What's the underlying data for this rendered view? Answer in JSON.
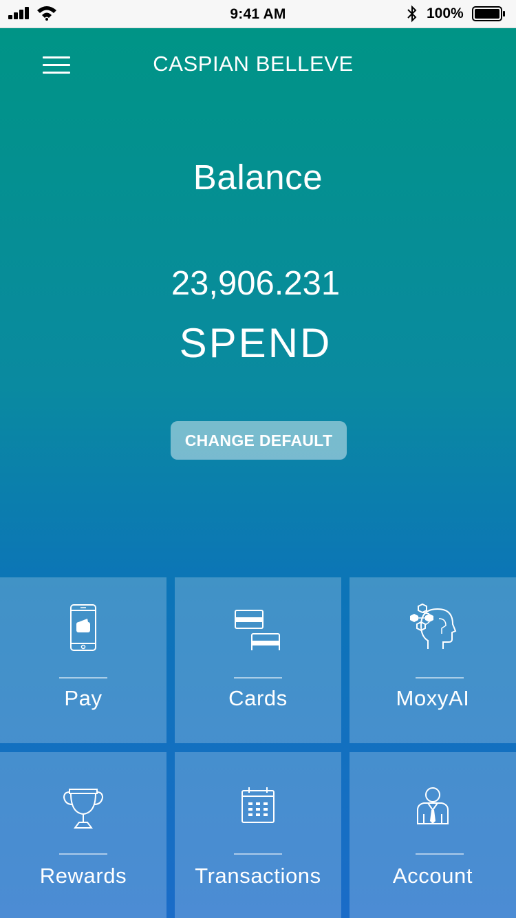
{
  "status_bar": {
    "time": "9:41 AM",
    "battery_percent": "100%",
    "icons": [
      "signal-icon",
      "wifi-icon",
      "bluetooth-icon",
      "battery-icon"
    ]
  },
  "header": {
    "title": "CASPIAN BELLEVE",
    "menu_icon": "hamburger-menu-icon"
  },
  "balance": {
    "label": "Balance",
    "amount": "23,906.231",
    "currency": "SPEND"
  },
  "change_default_button": "CHANGE DEFAULT",
  "tiles": [
    {
      "label": "Pay",
      "icon": "mobile-wallet-icon"
    },
    {
      "label": "Cards",
      "icon": "cards-icon"
    },
    {
      "label": "MoxyAI",
      "icon": "ai-head-icon"
    },
    {
      "label": "Rewards",
      "icon": "trophy-icon"
    },
    {
      "label": "Transactions",
      "icon": "calendar-icon"
    },
    {
      "label": "Account",
      "icon": "user-account-icon"
    }
  ],
  "colors": {
    "gradient_top": "#009486",
    "gradient_bottom": "#1a6cc8",
    "tile_overlay": "rgba(255,255,255,0.22)",
    "text": "#ffffff"
  }
}
